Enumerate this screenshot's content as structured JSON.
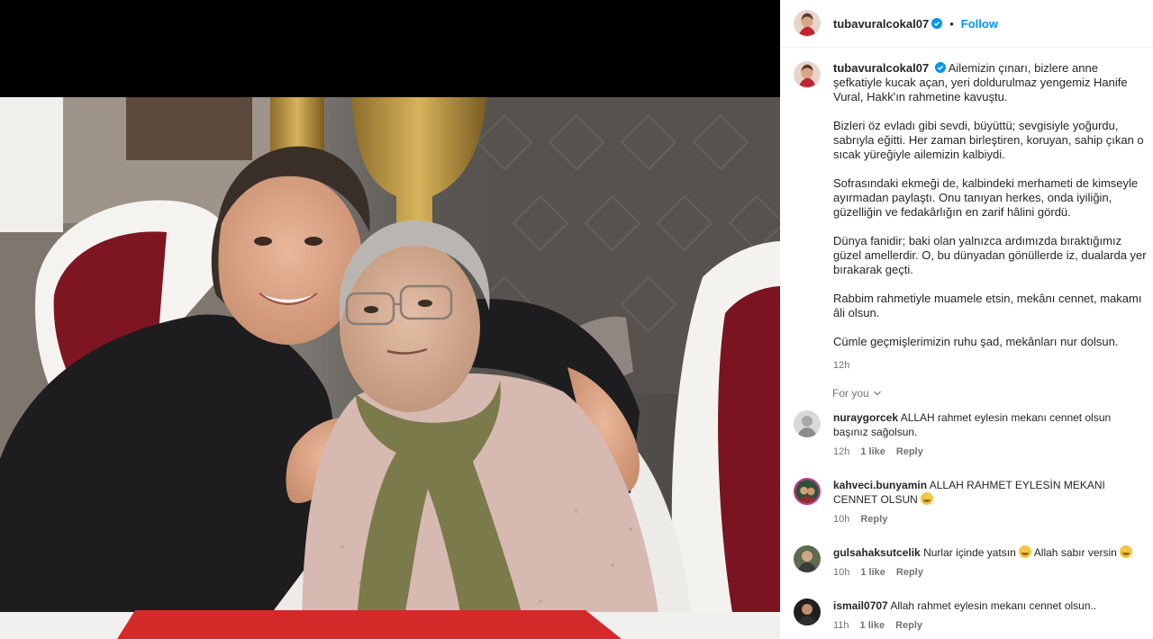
{
  "post": {
    "author": "tubavuralcokal07",
    "follow_label": "Follow",
    "separator": "•",
    "caption_paragraphs": [
      "Ailemizin çınarı, bizlere anne şefkatiyle kucak açan, yeri doldurulmaz yengemiz Hanife Vural, Hakk'ın rahmetine kavuştu.",
      "Bizleri öz evladı gibi sevdi, büyüttü; sevgisiyle yoğurdu, sabrıyla eğitti. Her zaman birleştiren, koruyan, sahip çıkan o sıcak yüreğiyle ailemizin kalbiydi.",
      "Sofrasındaki ekmeği de, kalbindeki merhameti de kimseyle ayırmadan paylaştı. Onu tanıyan herkes, onda iyiliğin, güzelliğin ve fedakârlığın en zarif hâlini gördü.",
      "Dünya fanidir; baki olan yalnızca ardımızda bıraktığımız güzel amellerdir. O, bu dünyadan gönüllerde iz, dualarda yer bırakarak geçti.",
      "Rabbim rahmetiyle muamele etsin, mekânı cennet, makamı âli olsun.",
      "Cümle geçmişlerimizin ruhu şad, mekânları nur dolsun."
    ],
    "time": "12h",
    "for_you_label": "For you"
  },
  "comments": [
    {
      "user": "nuraygorcek",
      "text": "ALLAH rahmet eylesin mekanı cennet olsun başınız sağolsun.",
      "time": "12h",
      "likes": "1 like",
      "reply": "Reply"
    },
    {
      "user": "kahveci.bunyamin",
      "text": "ALLAH RAHMET EYLESİN MEKANI CENNET OLSUN",
      "time": "10h",
      "likes": "",
      "reply": "Reply"
    },
    {
      "user": "gulsahaksutcelik",
      "text_a": "Nurlar içinde yatsın",
      "text_b": "Allah sabır versin",
      "time": "10h",
      "likes": "1 like",
      "reply": "Reply"
    },
    {
      "user": "ismail0707",
      "text": "Allah rahmet eylesin mekanı cennet olsun..",
      "time": "11h",
      "likes": "1 like",
      "reply": "Reply"
    }
  ],
  "colors": {
    "accent": "#0095f6",
    "verified": "#0095f6",
    "muted": "#737373"
  }
}
